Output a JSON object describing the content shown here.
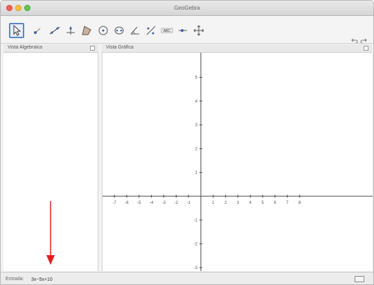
{
  "window": {
    "title": "GeoGebra"
  },
  "toolbar": {
    "tools": [
      {
        "name": "move-tool",
        "icon": "cursor-icon",
        "active": true
      },
      {
        "name": "point-tool",
        "icon": "point-icon"
      },
      {
        "name": "line-tool",
        "icon": "line-icon"
      },
      {
        "name": "perpendicular-tool",
        "icon": "perpendicular-icon"
      },
      {
        "name": "polygon-tool",
        "icon": "polygon-icon"
      },
      {
        "name": "circle-tool",
        "icon": "circle-icon"
      },
      {
        "name": "ellipse-tool",
        "icon": "ellipse-icon"
      },
      {
        "name": "angle-tool",
        "icon": "angle-icon"
      },
      {
        "name": "reflect-tool",
        "icon": "reflect-icon"
      },
      {
        "name": "text-tool",
        "icon": "abc-icon",
        "label": "ABC"
      },
      {
        "name": "slider-tool",
        "icon": "slider-icon"
      },
      {
        "name": "move-view-tool",
        "icon": "move-view-icon"
      }
    ]
  },
  "panels": {
    "algebra": {
      "title": "Vista Algebraica"
    },
    "graphics": {
      "title": "Vista Gráfica"
    }
  },
  "axes": {
    "x_ticks": [
      "-8",
      "-7",
      "-6",
      "-5",
      "-4",
      "-3",
      "-2",
      "-1",
      "0",
      "1",
      "2",
      "3",
      "4",
      "5",
      "6",
      "7",
      "8"
    ],
    "y_ticks": [
      "6",
      "5",
      "4",
      "3",
      "2",
      "1",
      "-1",
      "-2",
      "-3"
    ]
  },
  "inputbar": {
    "label": "Entrada:",
    "value": "3x−5x+10"
  },
  "colors": {
    "accent": "#5b86c5",
    "annotation": "#e02020"
  }
}
